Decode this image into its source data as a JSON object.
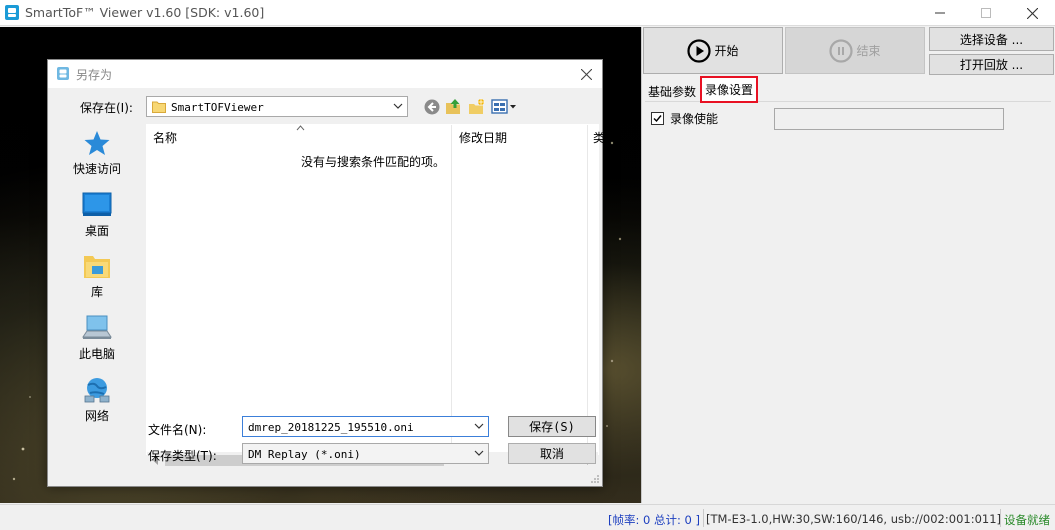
{
  "window": {
    "title": "SmartToF™ Viewer v1.60 [SDK: v1.60]"
  },
  "toolbar": {
    "start_label": "开始",
    "stop_label": "结束",
    "select_device_label": "选择设备 ...",
    "open_playback_label": "打开回放 ..."
  },
  "tabs": [
    {
      "label": "基础参数",
      "active": false
    },
    {
      "label": "录像设置",
      "active": true
    }
  ],
  "record": {
    "enable_label": "录像使能",
    "enabled": true,
    "path_value": ""
  },
  "status": {
    "fps": "[帧率: 0 总计: 0 ]",
    "device_info": "[TM-E3-1.0,HW:30,SW:160/146, usb://002:001:011]",
    "ready": "设备就绪"
  },
  "dialog": {
    "title": "另存为",
    "save_in_label": "保存在(I):",
    "save_in_value": "SmartTOFViewer",
    "places": [
      {
        "label": "快速访问",
        "icon": "star-icon"
      },
      {
        "label": "桌面",
        "icon": "desktop-icon"
      },
      {
        "label": "库",
        "icon": "library-icon"
      },
      {
        "label": "此电脑",
        "icon": "computer-icon"
      },
      {
        "label": "网络",
        "icon": "network-icon"
      }
    ],
    "columns": {
      "name": "名称",
      "modified": "修改日期",
      "type_partial": "类"
    },
    "empty_message": "没有与搜索条件匹配的项。",
    "filename_label": "文件名(N):",
    "filename_value": "dmrep_20181225_195510.oni",
    "filetype_label": "保存类型(T):",
    "filetype_value": "DM Replay (*.oni)",
    "save_button": "保存(S)",
    "cancel_button": "取消"
  },
  "colors": {
    "highlight_border": "#e81123",
    "status_fps": "#1d3fbf",
    "status_ready": "#2a8a2a"
  }
}
